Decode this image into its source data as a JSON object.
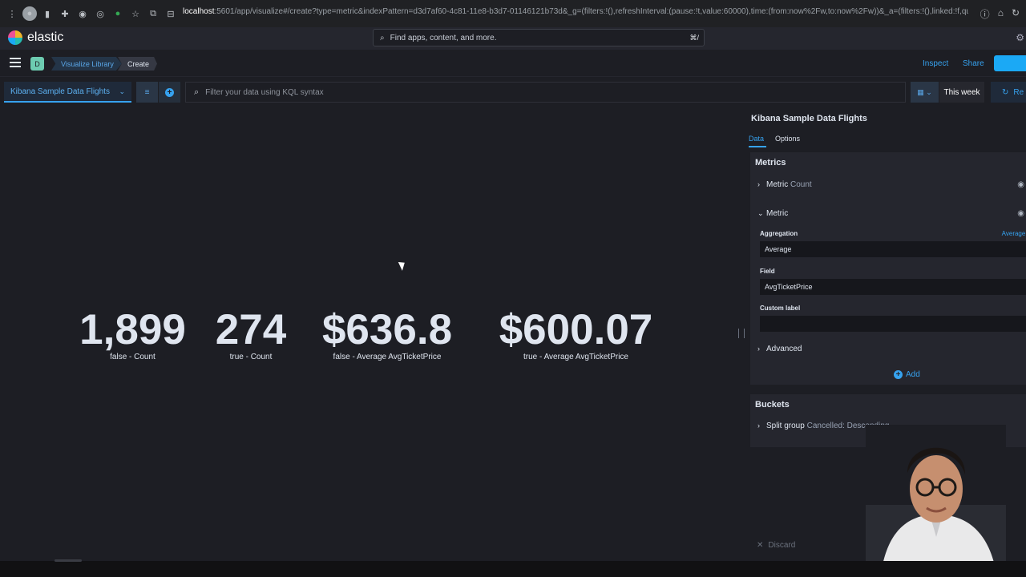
{
  "browser": {
    "url_host": "localhost",
    "url_rest": ":5601/app/visualize#/create?type=metric&indexPattern=d3d7af60-4c81-11e8-b3d7-01146121b73d&_g=(filters:!(),refreshInterval:(pause:!t,value:60000),time:(from:now%2Fw,to:now%2Fw))&_a=(filters:!(),linked:!f,query:(l..."
  },
  "header": {
    "app_name": "elastic",
    "search_placeholder": "Find apps, content, and more.",
    "search_shortcut": "⌘/"
  },
  "breadcrumb": {
    "space_initial": "D",
    "library": "Visualize Library",
    "current": "Create"
  },
  "top_nav": {
    "inspect": "Inspect",
    "share": "Share"
  },
  "query": {
    "index_pattern": "Kibana Sample Data Flights",
    "kql_placeholder": "Filter your data using KQL syntax",
    "date_range": "This week",
    "refresh": "Re"
  },
  "metrics": [
    {
      "value": "1,899",
      "label": "false - Count"
    },
    {
      "value": "274",
      "label": "true - Count"
    },
    {
      "value": "$636.8",
      "label": "false - Average AvgTicketPrice"
    },
    {
      "value": "$600.07",
      "label": "true - Average AvgTicketPrice"
    }
  ],
  "panel": {
    "title": "Kibana Sample Data Flights",
    "tabs": {
      "data": "Data",
      "options": "Options"
    },
    "metrics_title": "Metrics",
    "metric1": {
      "label": "Metric",
      "sub": "Count"
    },
    "metric2": {
      "label": "Metric"
    },
    "aggregation_label": "Aggregation",
    "aggregation_help": "Average h",
    "aggregation_value": "Average",
    "field_label": "Field",
    "field_value": "AvgTicketPrice",
    "custom_label": "Custom label",
    "custom_value": "",
    "advanced": "Advanced",
    "add": "Add",
    "buckets_title": "Buckets",
    "split_group": {
      "label": "Split group",
      "sub": "Cancelled: Descending"
    },
    "discard": "Discard"
  }
}
